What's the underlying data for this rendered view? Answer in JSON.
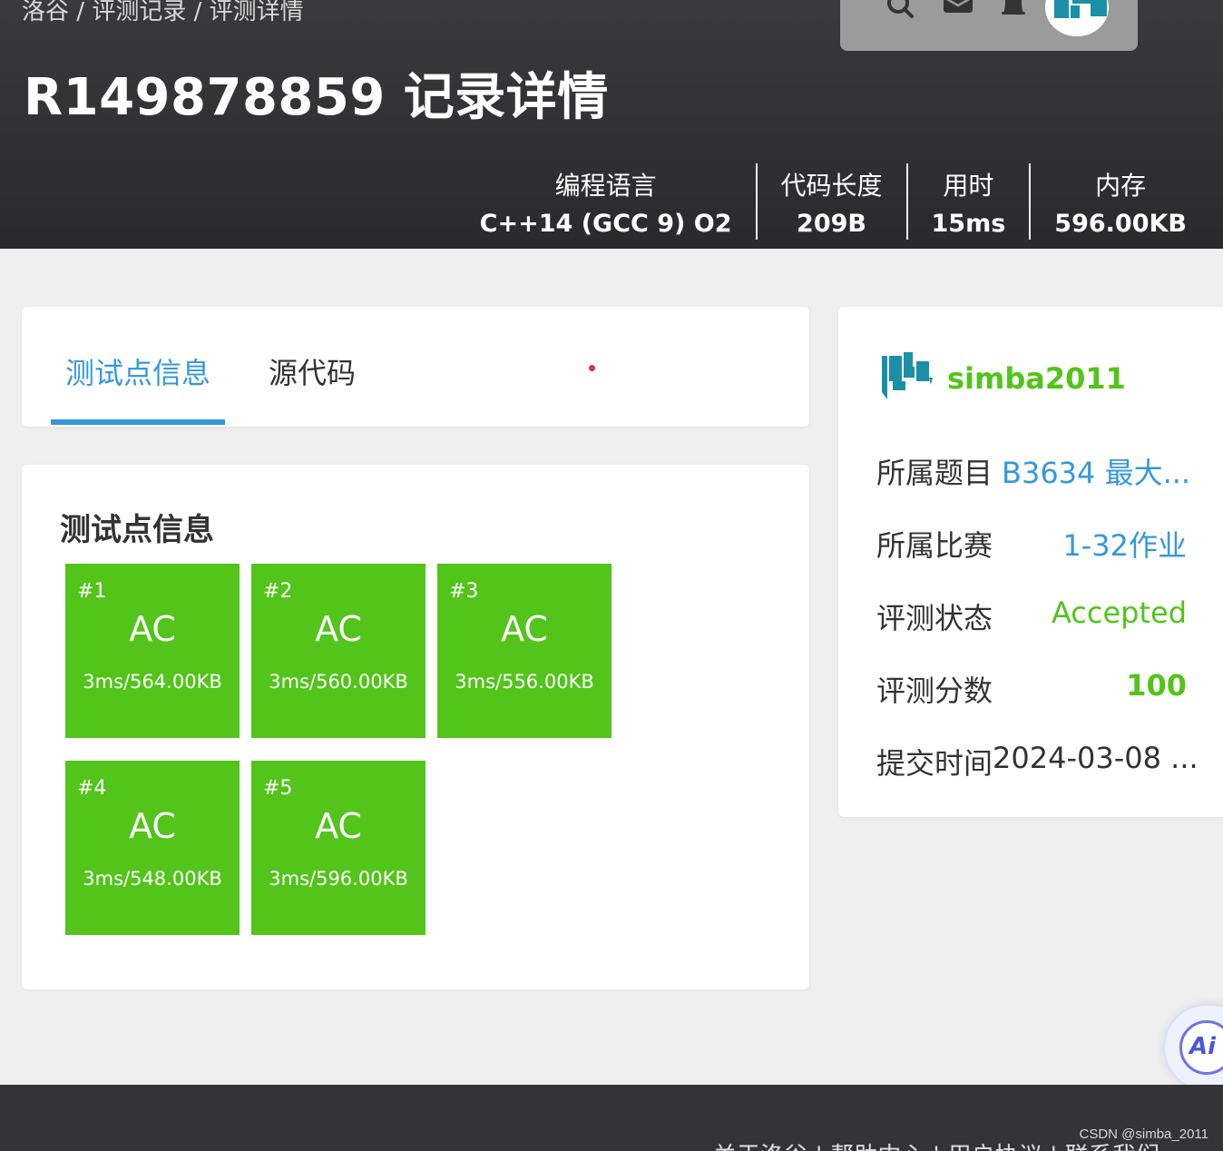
{
  "breadcrumb": {
    "items": [
      "洛谷",
      "评测记录",
      "评测详情"
    ],
    "separator": " / "
  },
  "page_title": "R149878859 记录详情",
  "nav": {
    "icons": [
      "search-icon",
      "mail-icon",
      "bell-icon"
    ]
  },
  "stats": [
    {
      "label": "编程语言",
      "value": "C++14 (GCC 9) O2"
    },
    {
      "label": "代码长度",
      "value": "209B"
    },
    {
      "label": "用时",
      "value": "15ms"
    },
    {
      "label": "内存",
      "value": "596.00KB"
    }
  ],
  "tabs": [
    {
      "label": "测试点信息",
      "active": true
    },
    {
      "label": "源代码",
      "active": false
    }
  ],
  "testcases": {
    "title": "测试点信息",
    "cases": [
      {
        "id": "#1",
        "status": "AC",
        "meta": "3ms/564.00KB"
      },
      {
        "id": "#2",
        "status": "AC",
        "meta": "3ms/560.00KB"
      },
      {
        "id": "#3",
        "status": "AC",
        "meta": "3ms/556.00KB"
      },
      {
        "id": "#4",
        "status": "AC",
        "meta": "3ms/548.00KB"
      },
      {
        "id": "#5",
        "status": "AC",
        "meta": "3ms/596.00KB"
      }
    ]
  },
  "sidebar": {
    "username": "simba2011",
    "rows": [
      {
        "label": "所属题目",
        "value": "B3634 最大..."
      },
      {
        "label": "所属比赛",
        "value": "1-32作业"
      },
      {
        "label": "评测状态",
        "value": "Accepted"
      },
      {
        "label": "评测分数",
        "value": "100"
      },
      {
        "label": "提交时间",
        "value": "2024-03-08 ..."
      }
    ]
  },
  "ai_button": {
    "label": "Ai"
  },
  "footer": {
    "links": [
      "关于洛谷",
      "帮助中心",
      "用户协议",
      "联系我们"
    ],
    "separator": " | "
  },
  "watermark": "CSDN @simba_2011",
  "colors": {
    "accent_blue": "#3498db",
    "ac_green": "#52c41a",
    "header_bg": "#2e2e30",
    "page_bg": "#efefef"
  }
}
